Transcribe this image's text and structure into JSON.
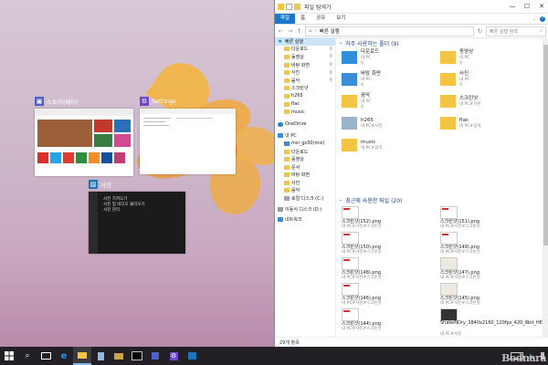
{
  "snap_assist": [
    {
      "title": "스토어(베타)",
      "icon": "store-icon",
      "color": "#4f5fc7"
    },
    {
      "title": "Settings",
      "icon": "gear-icon",
      "color": "#6b49c9"
    },
    {
      "title": "사진",
      "icon": "photos-icon",
      "color": "#1f73b8"
    }
  ],
  "photos_text": [
    "사진 가져오기",
    "사진 및 비디오 불러오기",
    "사진 관리"
  ],
  "explorer": {
    "window_title": "파일 탐색기",
    "ribbon_tabs": [
      "파일",
      "홈",
      "공유",
      "보기"
    ],
    "address": "빠른 실행",
    "search_placeholder": "빠른 실행 검색",
    "nav_quick": "빠른 실행",
    "nav_items": [
      {
        "label": "다운로드",
        "pinned": true
      },
      {
        "label": "동영상",
        "pinned": true
      },
      {
        "label": "바탕 화면",
        "pinned": true
      },
      {
        "label": "사진",
        "pinned": true
      },
      {
        "label": "음악",
        "pinned": true
      },
      {
        "label": "스크린샷",
        "pinned": false
      },
      {
        "label": "h265",
        "pinned": false
      },
      {
        "label": "flac",
        "pinned": false
      },
      {
        "label": "music",
        "pinned": false
      }
    ],
    "nav_onedrive": "OneDrive",
    "nav_pc": "내 PC",
    "nav_pc_items": [
      "msi_gs30(msi)",
      "다운로드",
      "동영상",
      "문서",
      "바탕 화면",
      "사진",
      "음악",
      "로컬 디스크 (C:)",
      "이동식 디스크 (D:)"
    ],
    "nav_removable": "이동식 디스크 (D:)",
    "nav_network": "네트워크",
    "frequent_header": "자주 사용하는 폴더 (9)",
    "frequent": [
      {
        "name": "다운로드",
        "sub": "내 PC",
        "pin": true
      },
      {
        "name": "동영상",
        "sub": "내 PC",
        "pin": true
      },
      {
        "name": "바탕 화면",
        "sub": "내 PC",
        "pin": true
      },
      {
        "name": "사진",
        "sub": "내 PC",
        "pin": true
      },
      {
        "name": "음악",
        "sub": "내 PC",
        "pin": true
      },
      {
        "name": "스크린샷",
        "sub": "내 PC#사진",
        "pin": false
      },
      {
        "name": "h265",
        "sub": "내 PC#사진",
        "pin": false
      },
      {
        "name": "flac",
        "sub": "내 PC#음악",
        "pin": false
      },
      {
        "name": "music",
        "sub": "내 PC#음악",
        "pin": false
      }
    ],
    "recent_header": "최근에 사용한 파일 (20)",
    "recent": [
      {
        "name": "스크린샷(152).png",
        "sub": "내 PC#사진#스크린샷"
      },
      {
        "name": "스크린샷(151).png",
        "sub": "내 PC#사진#스크린샷"
      },
      {
        "name": "스크린샷(150).png",
        "sub": "내 PC#사진#스크린샷"
      },
      {
        "name": "스크린샷(149).png",
        "sub": "내 PC#사진#스크린샷"
      },
      {
        "name": "스크린샷(148).png",
        "sub": "내 PC#사진#스크린샷"
      },
      {
        "name": "스크린샷(147).png",
        "sub": "내 PC#사진#스크린샷"
      },
      {
        "name": "스크린샷(146).png",
        "sub": "내 PC#사진#스크린샷"
      },
      {
        "name": "스크린샷(145).png",
        "sub": "내 PC#사진#스크린샷"
      },
      {
        "name": "스크린샷(144).png",
        "sub": "내 PC#사진#스크린샷"
      },
      {
        "name": "ShakeNDry_3840x2160_120fps_420_8bit_HEVC_MP4.mp4",
        "sub": "내 PC#사진"
      }
    ],
    "status": "29개 항목"
  },
  "watermark": "Bodnara",
  "colors": {
    "accent": "#1979ca",
    "folder": "#f4c542",
    "taskbar": "#222024"
  }
}
